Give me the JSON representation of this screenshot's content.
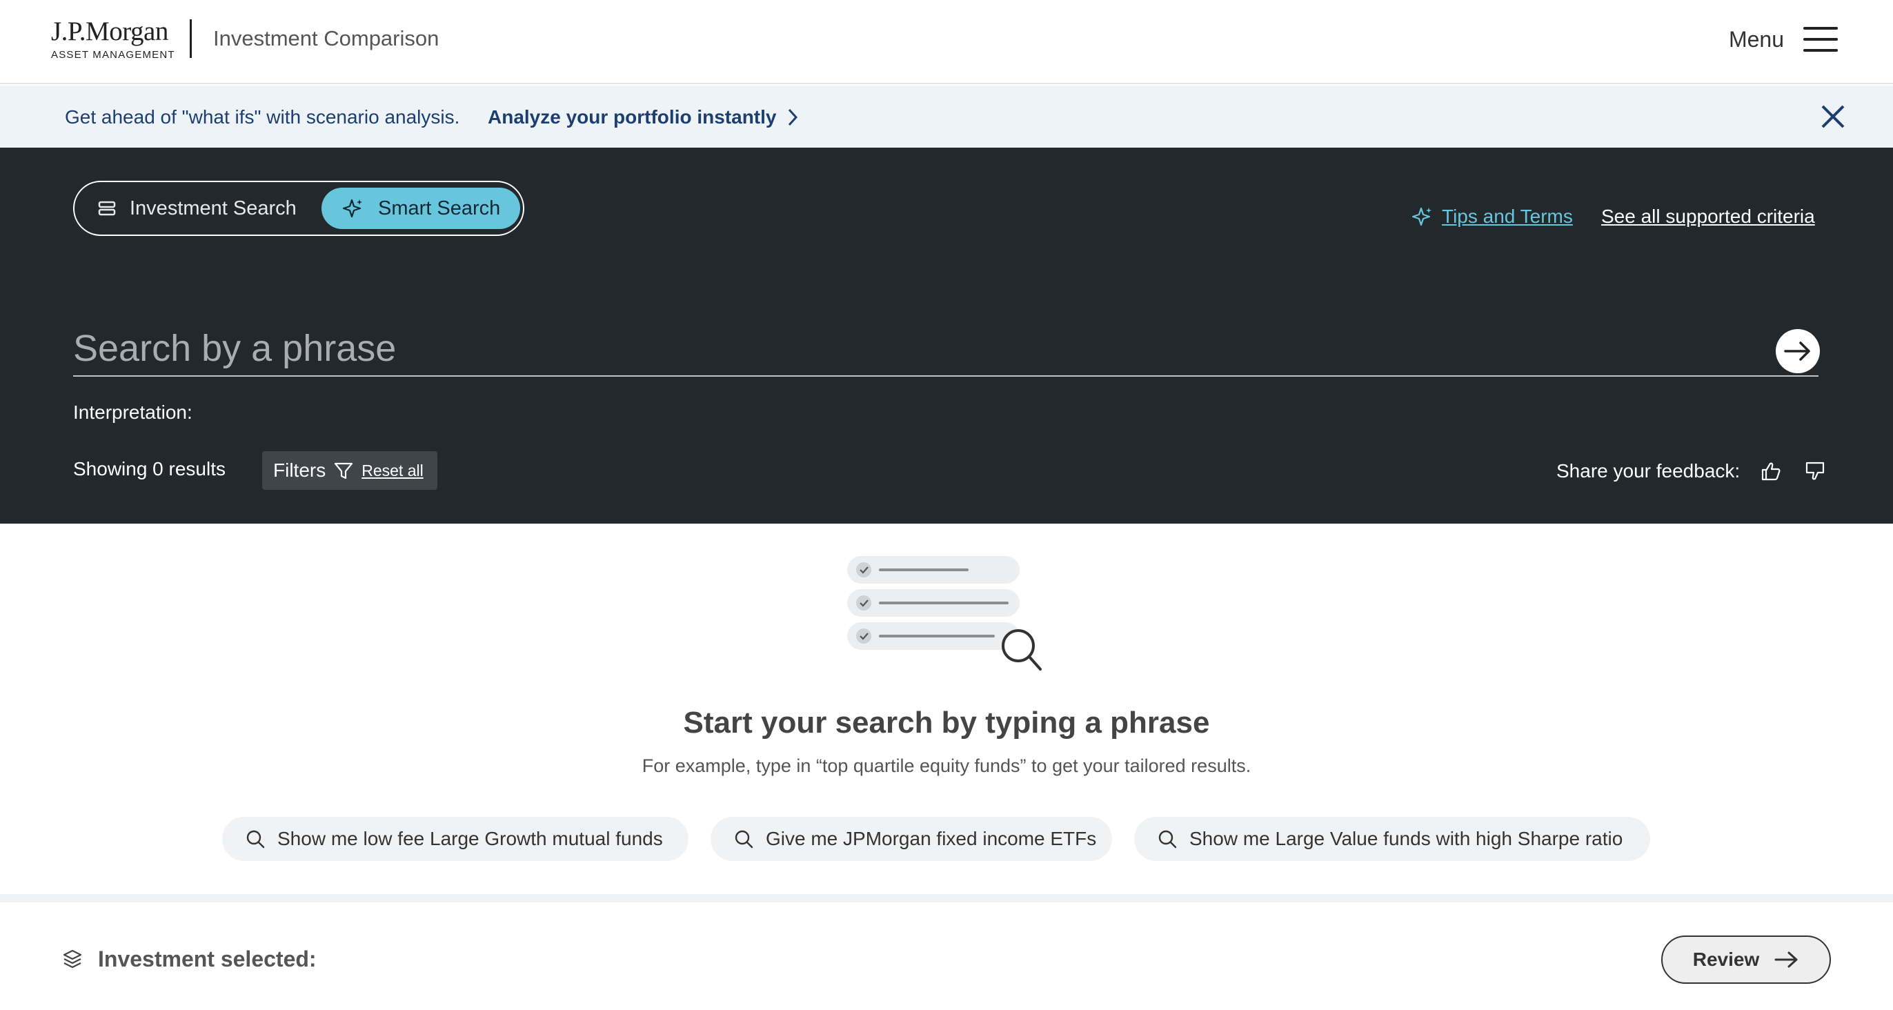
{
  "header": {
    "logo_main": "J.P.Morgan",
    "logo_sub": "ASSET MANAGEMENT",
    "app_title": "Investment Comparison",
    "menu_label": "Menu"
  },
  "banner": {
    "text": "Get ahead of \"what ifs\" with scenario analysis.",
    "link": "Analyze your portfolio instantly"
  },
  "search_panel": {
    "toggle": {
      "options": [
        {
          "label": "Investment Search",
          "icon": "list-icon",
          "selected": false
        },
        {
          "label": "Smart Search",
          "icon": "sparkle-icon",
          "selected": true
        }
      ]
    },
    "tips_link": "Tips and Terms",
    "criteria_link": "See all supported criteria",
    "search_placeholder": "Search by a phrase",
    "search_value": "",
    "interpretation_label": "Interpretation:",
    "results_text": "Showing 0 results",
    "filters_label": "Filters",
    "reset_label": "Reset all",
    "feedback_label": "Share your feedback:"
  },
  "empty_state": {
    "title": "Start your search by typing a phrase",
    "subtitle": "For example, type in “top quartile equity funds” to get your tailored results.",
    "suggestions": [
      "Show me low fee Large Growth mutual funds",
      "Give me JPMorgan fixed income ETFs",
      "Show me Large Value funds with high Sharpe ratio"
    ]
  },
  "tray": {
    "label": "Investment selected:",
    "review_label": "Review"
  },
  "colors": {
    "accent": "#67c6dc",
    "panel_bg": "#23282d",
    "banner_bg": "#eef3f8",
    "banner_text": "#1d3f70"
  }
}
